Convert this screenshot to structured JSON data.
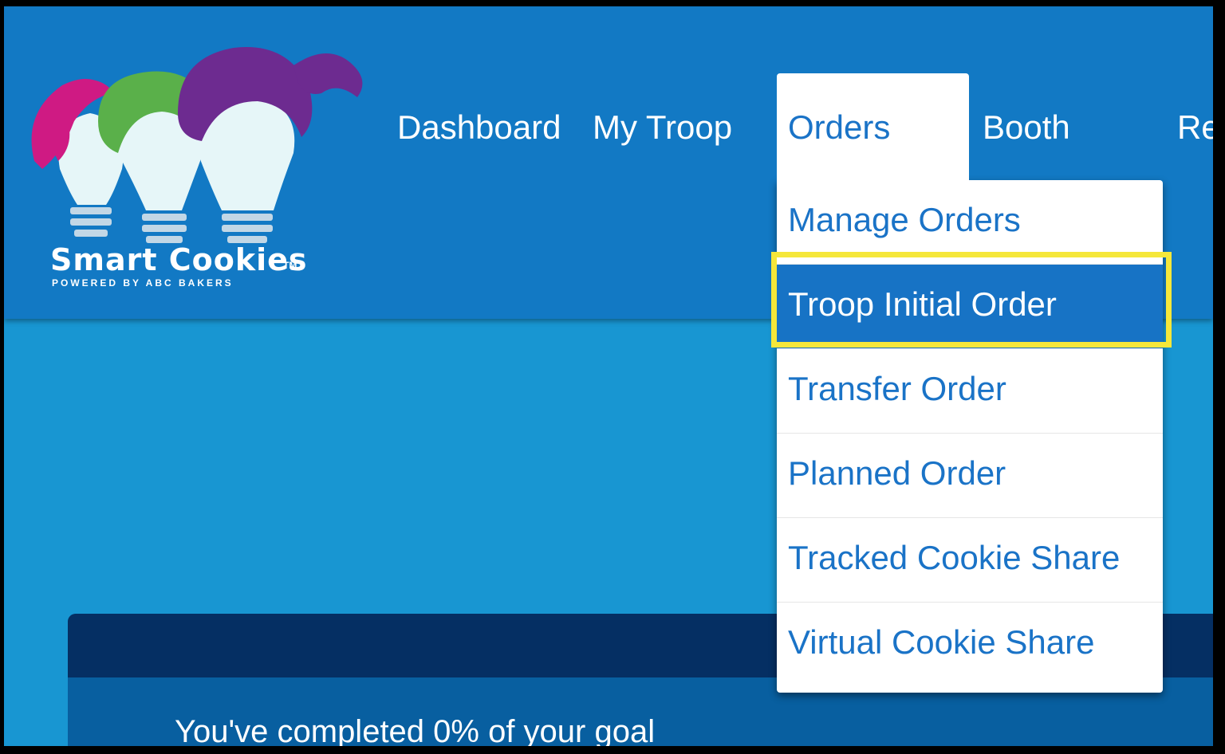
{
  "logo": {
    "name": "Smart Cookies",
    "tagline": "POWERED BY ABC BAKERS",
    "trademark": "TM"
  },
  "nav": {
    "items": [
      {
        "label": "Dashboard"
      },
      {
        "label": "My Troop"
      },
      {
        "label": "Orders"
      },
      {
        "label": "Booth"
      },
      {
        "label": "Re"
      }
    ]
  },
  "orders_menu": {
    "items": [
      {
        "label": "Manage Orders"
      },
      {
        "label": "Troop Initial Order",
        "selected": true
      },
      {
        "label": "Transfer Order"
      },
      {
        "label": "Planned Order"
      },
      {
        "label": "Tracked Cookie Share"
      },
      {
        "label": "Virtual Cookie Share"
      }
    ]
  },
  "goal": {
    "text": "You've completed 0% of your goal"
  },
  "colors": {
    "header": "#1279c4",
    "page_background": "#1896d2",
    "panel": "#085fa0",
    "panel_header": "#052f63",
    "menu_text": "#1a73c7",
    "menu_selected": "#1773c5",
    "highlight": "#f5e73a"
  }
}
